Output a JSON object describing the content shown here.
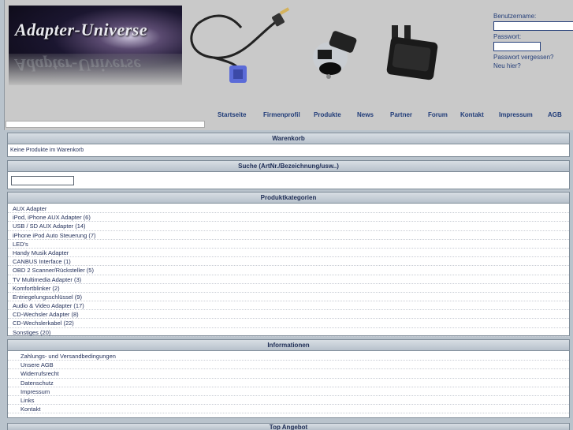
{
  "header": {
    "logo_text": "Adapter-Universe",
    "login": {
      "username_label": "Benutzername:",
      "password_label": "Passwort:",
      "forgot_link": "Passwort vergessen?",
      "register_link": "Neu hier?"
    }
  },
  "nav": {
    "items": [
      "Startseite",
      "Firmenprofil",
      "Produkte",
      "News",
      "Partner",
      "Forum",
      "Kontakt",
      "Impressum",
      "AGB"
    ]
  },
  "cart": {
    "title": "Warenkorb",
    "empty_text": "Keine Produkte im Warenkorb"
  },
  "search": {
    "title": "Suche (ArtNr./Bezeichnung/usw..)",
    "value": ""
  },
  "categories": {
    "title": "Produktkategorien",
    "items": [
      "AUX Adapter",
      "iPod, iPhone AUX Adapter (6)",
      "USB / SD AUX Adapter (14)",
      "iPhone iPod Auto Steuerung (7)",
      "LED's",
      "Handy Musik Adapter",
      "CANBUS Interface (1)",
      "OBD 2 Scanner/Rücksteller (5)",
      "TV Multimedia Adapter (3)",
      "Komfortblinker (2)",
      "Entriegelungsschlüssel (9)",
      "Audio & Video Adapter (17)",
      "CD-Wechsler Adapter (8)",
      "CD-Wechslerkabel (22)",
      "Sonstiges (20)"
    ]
  },
  "info": {
    "title": "Informationen",
    "items": [
      "Zahlungs- und Versandbedingungen",
      "Unsere AGB",
      "Widerrufsrecht",
      "Datenschutz",
      "Impressum",
      "Links",
      "Kontakt"
    ]
  },
  "top_offer": {
    "title": "Top Angebot"
  }
}
